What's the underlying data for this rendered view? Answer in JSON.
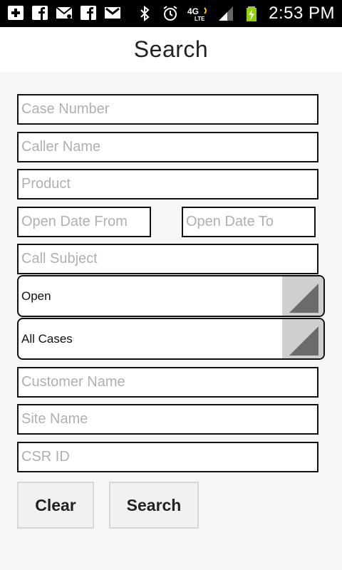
{
  "status_bar": {
    "time": "2:53 PM",
    "icons": [
      "add-icon",
      "facebook-icon",
      "email-icon",
      "facebook-icon",
      "gmail-icon",
      "bluetooth-icon",
      "alarm-icon",
      "4g-lte-icon",
      "signal-icon",
      "battery-charging-icon"
    ]
  },
  "header": {
    "title": "Search"
  },
  "form": {
    "case_number_placeholder": "Case Number",
    "caller_name_placeholder": "Caller Name",
    "product_placeholder": "Product",
    "open_date_from_placeholder": "Open Date From",
    "open_date_to_placeholder": "Open Date To",
    "call_subject_placeholder": "Call Subject",
    "status_select_value": "Open",
    "cases_select_value": "All Cases",
    "customer_name_placeholder": "Customer Name",
    "site_name_placeholder": "Site Name",
    "csr_id_placeholder": "CSR ID"
  },
  "buttons": {
    "clear_label": "Clear",
    "search_label": "Search"
  }
}
